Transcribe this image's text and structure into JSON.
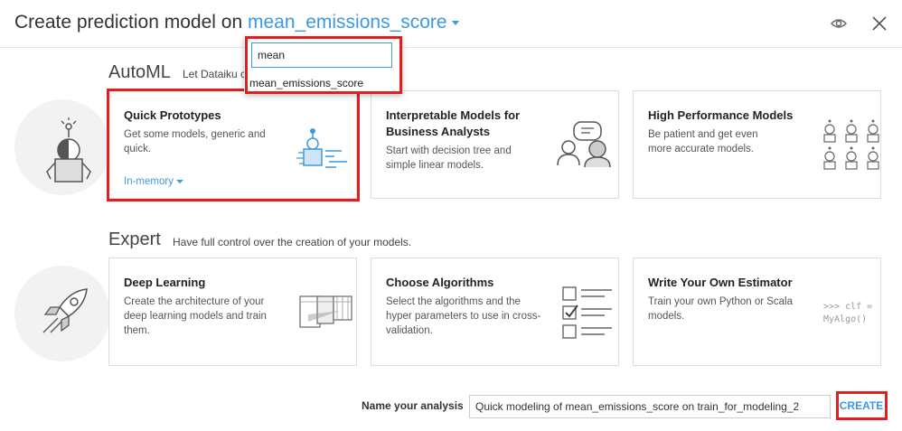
{
  "header": {
    "title_prefix": "Create prediction model on",
    "target": "mean_emissions_score"
  },
  "target_dropdown": {
    "search_value": "mean",
    "options": [
      "mean_emissions_score"
    ]
  },
  "automl": {
    "title": "AutoML",
    "subtitle": "Let Dataiku c",
    "cards": [
      {
        "title": "Quick Prototypes",
        "desc": "Get some models, generic and quick.",
        "backend": "In-memory"
      },
      {
        "title": "Interpretable Models for Business Analysts",
        "desc": "Start with decision tree and simple linear models."
      },
      {
        "title": "High Performance Models",
        "desc": "Be patient and get even more accurate models."
      }
    ]
  },
  "expert": {
    "title": "Expert",
    "subtitle": "Have full control over the creation of your models.",
    "cards": [
      {
        "title": "Deep Learning",
        "desc": "Create the architecture of your deep learning models and train them."
      },
      {
        "title": "Choose Algorithms",
        "desc": "Select the algorithms and the hyper parameters to use in cross-validation."
      },
      {
        "title": "Write Your Own Estimator",
        "desc": "Train your own Python or Scala models.",
        "code_line1": ">>> clf =",
        "code_line2": "MyAlgo()"
      }
    ]
  },
  "footer": {
    "name_label": "Name your analysis",
    "name_value": "Quick modeling of mean_emissions_score on train_for_modeling_2",
    "create_label": "CREATE"
  },
  "colors": {
    "accent": "#3b99e0",
    "highlight": "#e02020"
  }
}
